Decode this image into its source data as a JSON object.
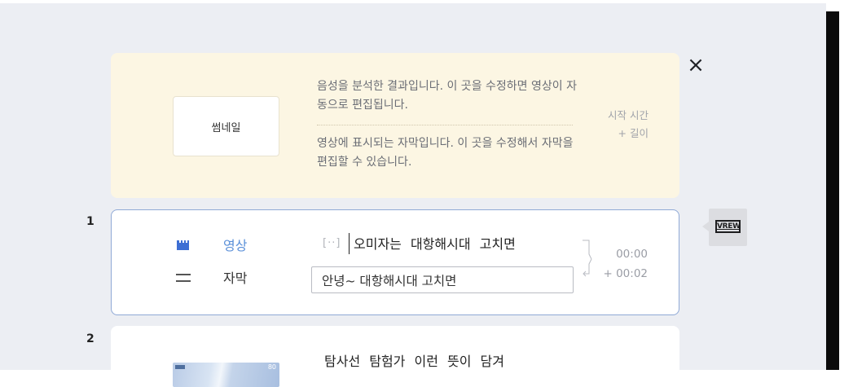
{
  "close": {
    "icon": "close-icon",
    "label": "×"
  },
  "guide": {
    "thumbnail_label": "썸네일",
    "audio_desc": "음성을 분석한 결과입니다. 이 곳을 수정하면 영상이 자동으로 편집됩니다.",
    "subtitle_desc": "영상에 표시되는 자막입니다. 이 곳을 수정해서 자막을 편집할 수 있습니다.",
    "time_start_label": "시작 시간",
    "time_length_label": "+ 길이"
  },
  "clips": [
    {
      "number": "1",
      "video_label": "영상",
      "subtitle_label": "자막",
      "silence_marker": "[··]",
      "words": "오미자는 대항해시대 고치면",
      "subtitle_value": "안녕~ 대항해시대 고치면",
      "start": "00:00",
      "duration": "+ 00:02"
    },
    {
      "number": "2",
      "words": "탐사선 탐험가 이런 뜻이 담겨",
      "thumb_mark": "80"
    }
  ],
  "vrew": {
    "logo_text": "VREW",
    "icon": "vrew-logo-icon"
  },
  "colors": {
    "panel_bg": "#eceef3",
    "guide_bg": "#fcf6e3",
    "accent_blue": "#5a8fd8",
    "active_border": "#8fa9d6"
  }
}
